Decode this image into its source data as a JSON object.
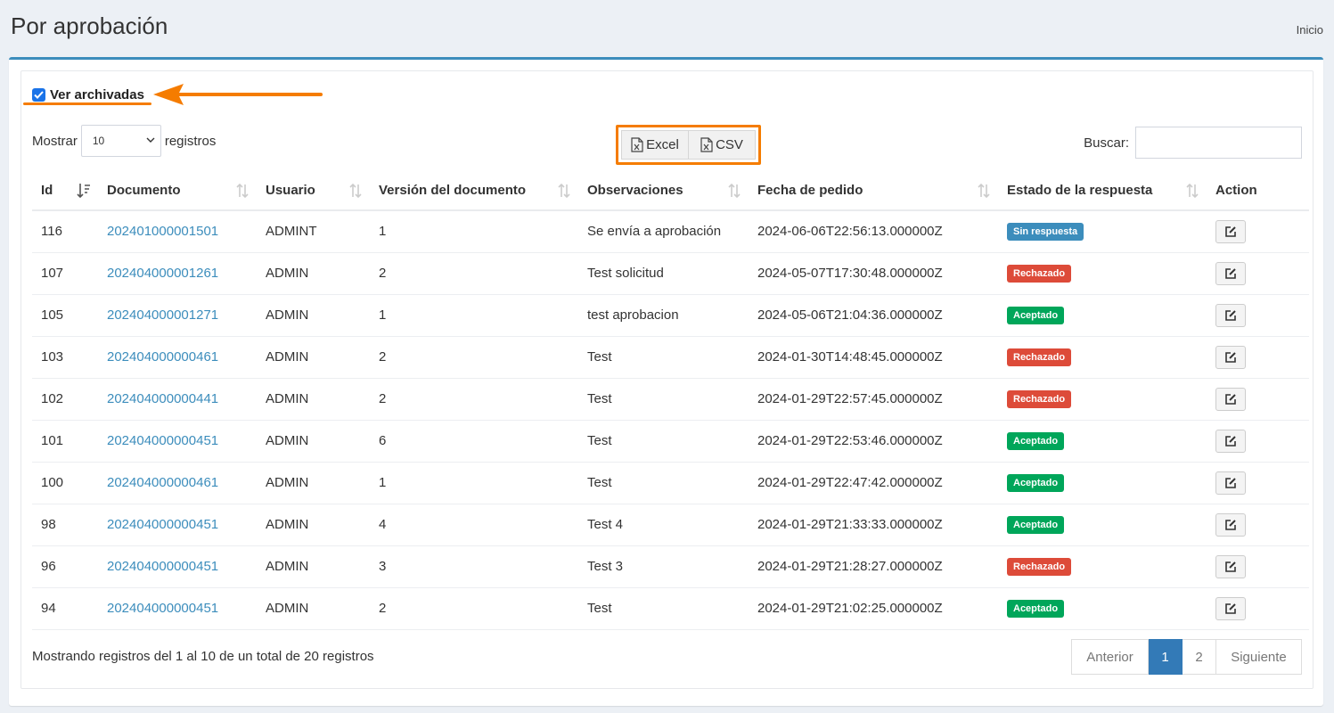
{
  "header": {
    "title": "Por aprobación",
    "breadcrumb": "Inicio"
  },
  "archive": {
    "label": "Ver archivadas",
    "checked": true
  },
  "length": {
    "prefix": "Mostrar",
    "value": "10",
    "suffix": "registros"
  },
  "export": {
    "excel_label": "Excel",
    "csv_label": "CSV"
  },
  "search": {
    "label": "Buscar:",
    "value": ""
  },
  "table": {
    "columns": [
      "Id",
      "Documento",
      "Usuario",
      "Versión del documento",
      "Observaciones",
      "Fecha de pedido",
      "Estado de la respuesta",
      "Action"
    ],
    "rows": [
      {
        "id": "116",
        "documento": "202401000001501",
        "usuario": "ADMINT",
        "version": "1",
        "observaciones": "Se envía a aprobación",
        "fecha": "2024-06-06T22:56:13.000000Z",
        "estado": "Sin respuesta"
      },
      {
        "id": "107",
        "documento": "202404000001261",
        "usuario": "ADMIN",
        "version": "2",
        "observaciones": "Test solicitud",
        "fecha": "2024-05-07T17:30:48.000000Z",
        "estado": "Rechazado"
      },
      {
        "id": "105",
        "documento": "202404000001271",
        "usuario": "ADMIN",
        "version": "1",
        "observaciones": "test aprobacion",
        "fecha": "2024-05-06T21:04:36.000000Z",
        "estado": "Aceptado"
      },
      {
        "id": "103",
        "documento": "202404000000461",
        "usuario": "ADMIN",
        "version": "2",
        "observaciones": "Test",
        "fecha": "2024-01-30T14:48:45.000000Z",
        "estado": "Rechazado"
      },
      {
        "id": "102",
        "documento": "202404000000441",
        "usuario": "ADMIN",
        "version": "2",
        "observaciones": "Test",
        "fecha": "2024-01-29T22:57:45.000000Z",
        "estado": "Rechazado"
      },
      {
        "id": "101",
        "documento": "202404000000451",
        "usuario": "ADMIN",
        "version": "6",
        "observaciones": "Test",
        "fecha": "2024-01-29T22:53:46.000000Z",
        "estado": "Aceptado"
      },
      {
        "id": "100",
        "documento": "202404000000461",
        "usuario": "ADMIN",
        "version": "1",
        "observaciones": "Test",
        "fecha": "2024-01-29T22:47:42.000000Z",
        "estado": "Aceptado"
      },
      {
        "id": "98",
        "documento": "202404000000451",
        "usuario": "ADMIN",
        "version": "4",
        "observaciones": "Test 4",
        "fecha": "2024-01-29T21:33:33.000000Z",
        "estado": "Aceptado"
      },
      {
        "id": "96",
        "documento": "202404000000451",
        "usuario": "ADMIN",
        "version": "3",
        "observaciones": "Test 3",
        "fecha": "2024-01-29T21:28:27.000000Z",
        "estado": "Rechazado"
      },
      {
        "id": "94",
        "documento": "202404000000451",
        "usuario": "ADMIN",
        "version": "2",
        "observaciones": "Test",
        "fecha": "2024-01-29T21:02:25.000000Z",
        "estado": "Aceptado"
      }
    ]
  },
  "status_colors": {
    "Sin respuesta": "#3c8dbc",
    "Rechazado": "#dd4b39",
    "Aceptado": "#00a65a"
  },
  "info": "Mostrando registros del 1 al 10 de un total de 20 registros",
  "pagination": {
    "prev": "Anterior",
    "pages": [
      "1",
      "2"
    ],
    "active": "1",
    "next": "Siguiente"
  },
  "colors": {
    "accent": "#3c8dbc",
    "annotation": "#f57c00",
    "page_active": "#337ab7"
  }
}
